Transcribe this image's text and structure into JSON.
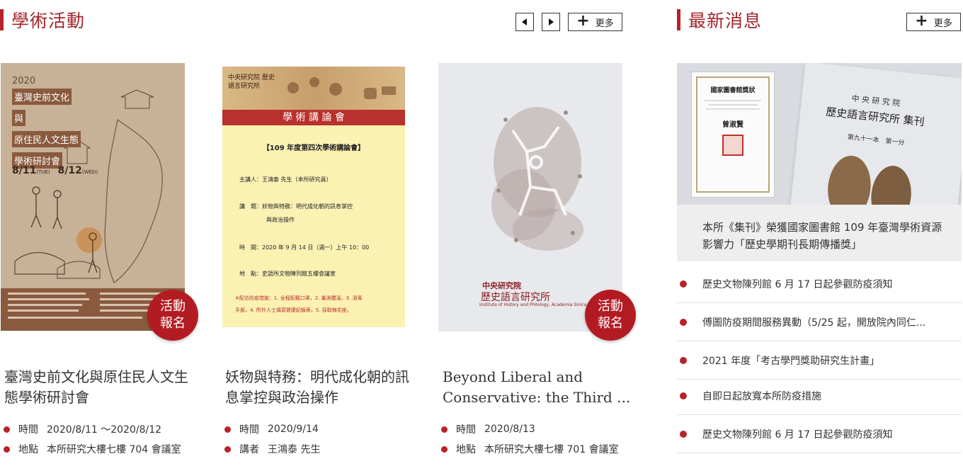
{
  "academic": {
    "title": "學術活動",
    "more_label": "更多",
    "cards": [
      {
        "title": "臺灣史前文化與原住民人文生態學術研討會",
        "badge_line1": "活動",
        "badge_line2": "報名",
        "poster": {
          "year": "2020",
          "lines": [
            "臺灣史前文化",
            "與",
            "原住民人文生態",
            "學術研討會"
          ],
          "date_a": "8/11",
          "date_a_day": "(TUE)",
          "date_b": "8/12",
          "date_b_day": "(WED)"
        },
        "meta": [
          {
            "key": "時間",
            "value": "2020/8/11 ～2020/8/12"
          },
          {
            "key": "地點",
            "value": "本所研究大樓七樓 704 會議室"
          }
        ]
      },
      {
        "title": "妖物與特務：明代成化朝的訊息掌控與政治操作",
        "poster": {
          "org": "中央研究院 歷史語言研究所",
          "banner": "學 術 講 論 會",
          "heading": "【109 年度第四次學術講論會】",
          "speaker": "主講人：王鴻泰 先生（本所研究員）",
          "topic_1": "講　題：妖物與特務：明代成化朝的訊息掌控",
          "topic_2": "與政治操作",
          "time": "時　間：2020 年 9 月 14 日（週一）上午 10：00",
          "place": "地　點：史語所文物陳列館五樓會議室",
          "note_1": "※配合防疫措施：1. 全程配戴口罩，2. 量測體溫，3. 消毒",
          "note_2": "手部，4. 所外人士填寫健康紀錄表，5. 採取梅花座。"
        },
        "meta": [
          {
            "key": "時間",
            "value": "2020/9/14"
          },
          {
            "key": "講者",
            "value": "王鴻泰 先生"
          }
        ]
      },
      {
        "title": "Beyond Liberal and Conservative: the Third ...",
        "badge_line1": "活動",
        "badge_line2": "報名",
        "poster": {
          "org_cn": "中央研究院",
          "inst_cn": "歷史語言研究所",
          "inst_en": "Institute of History and Philology, Academia Sinica"
        },
        "meta": [
          {
            "key": "時間",
            "value": "2020/8/13"
          },
          {
            "key": "地點",
            "value": "本所研究大樓七樓 701 會議室"
          }
        ]
      }
    ]
  },
  "news": {
    "title": "最新消息",
    "more_label": "更多",
    "image": {
      "certificate_title": "國家圖書館獎狀",
      "signature": "曾淑賢",
      "journal_org": "中 央 研 究 院",
      "journal_title": "歷史語言研究所 集刊",
      "journal_volume": "第九十一本　第一分"
    },
    "feature_text": "本所《集刊》榮獲國家圖書館 109 年臺灣學術資源影響力「歷史學期刊長期傳播獎」",
    "items": [
      "歷史文物陳列館 6 月 17 日起參觀防疫須知",
      "傅圖防疫期間服務異動（5/25 起，開放院內同仁...",
      "2021 年度「考古學門獎助研究生計畫」",
      "自即日起放寬本所防疫措施",
      "歷史文物陳列館 6 月 17 日起參觀防疫須知"
    ]
  },
  "colors": {
    "accent": "#a3262c",
    "badge": "#b31b22",
    "poster1_bg": "#c9b49c",
    "poster2_bg": "#fbf1b3",
    "poster3_bg": "#e8e9ec"
  }
}
